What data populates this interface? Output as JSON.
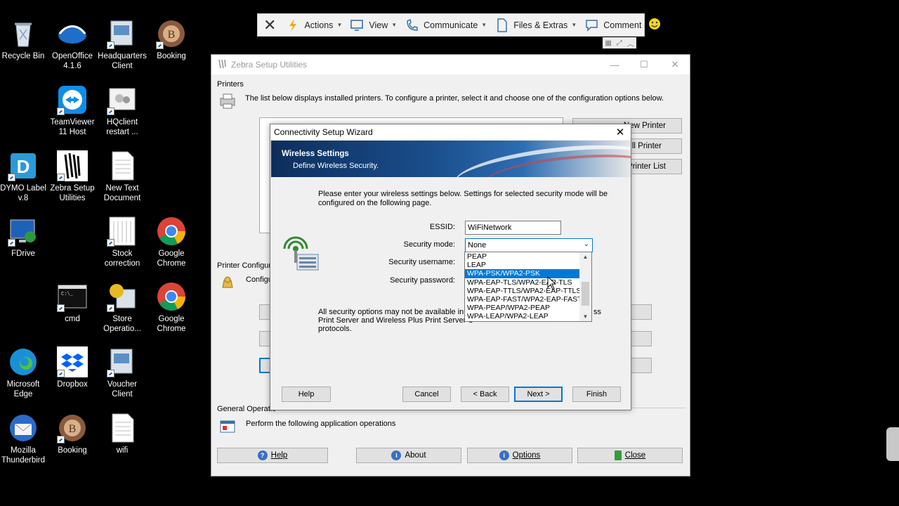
{
  "desktop": {
    "icons": [
      {
        "label": "Recycle Bin",
        "icon": "recycle-bin-icon"
      },
      {
        "label": "OpenOffice 4.1.6",
        "icon": "openoffice-icon"
      },
      {
        "label": "Headquarters Client",
        "icon": "app-icon"
      },
      {
        "label": "Booking",
        "icon": "booking-icon"
      },
      {
        "label": "TeamViewer 11 Host",
        "icon": "teamviewer-icon"
      },
      {
        "label": "HQclient restart ...",
        "icon": "app-icon"
      },
      {
        "label": "DYMO Label v.8",
        "icon": "dymo-icon"
      },
      {
        "label": "Zebra Setup Utilities",
        "icon": "zebra-icon"
      },
      {
        "label": "New Text Document",
        "icon": "text-document-icon"
      },
      {
        "label": "FDrive",
        "icon": "network-drive-icon"
      },
      {
        "label": "Stock correction",
        "icon": "document-icon"
      },
      {
        "label": "Google Chrome",
        "icon": "chrome-icon"
      },
      {
        "label": "cmd",
        "icon": "cmd-icon"
      },
      {
        "label": "Store Operatio...",
        "icon": "app-icon"
      },
      {
        "label": "Google Chrome",
        "icon": "chrome-icon"
      },
      {
        "label": "Microsoft Edge",
        "icon": "edge-icon"
      },
      {
        "label": "Dropbox",
        "icon": "dropbox-icon"
      },
      {
        "label": "Voucher Client",
        "icon": "app-icon"
      },
      {
        "label": "Mozilla Thunderbird",
        "icon": "thunderbird-icon"
      },
      {
        "label": "Booking",
        "icon": "booking-icon"
      },
      {
        "label": "wifi",
        "icon": "text-document-icon"
      }
    ]
  },
  "remote_toolbar": {
    "close": "close-icon",
    "actions": "Actions",
    "view": "View",
    "communicate": "Communicate",
    "files": "Files & Extras",
    "comment": "Comment"
  },
  "zebra": {
    "title": "Zebra Setup Utilities",
    "printers_label": "Printers",
    "printers_desc": "The list below displays installed printers. To configure a printer, select it and choose one of the configuration options below.",
    "new_printer": "New Printer",
    "install_printer": "ll Printer",
    "printer_list": "Printer List",
    "printer_config_label": "Printer Configur",
    "config_text": "Configu",
    "general_ops_label": "General Operatio",
    "general_ops_desc": "Perform the following application operations",
    "help": "Help",
    "about": "About",
    "options": "Options",
    "close": "Close"
  },
  "wizard": {
    "title": "Connectivity Setup Wizard",
    "banner_title": "Wireless Settings",
    "banner_subtitle": "Define Wireless Security.",
    "intro": "Please enter your wireless settings below. Settings for selected security mode will be configured on the following page.",
    "essid_label": "ESSID:",
    "essid_value": "WiFiNetwork",
    "security_mode_label": "Security mode:",
    "security_mode_value": "None",
    "security_username_label": "Security username:",
    "security_password_label": "Security password:",
    "note_line1": "All security options may not be available in",
    "note_tail": "ss",
    "note_line2a": "Print Server and Wireless Plus Print Server U",
    "note_line2b": "protocols.",
    "buttons": {
      "help": "Help",
      "cancel": "Cancel",
      "back": "< Back",
      "next": "Next >",
      "finish": "Finish"
    },
    "security_options": [
      "PEAP",
      "LEAP",
      "WPA-PSK/WPA2-PSK",
      "WPA-EAP-TLS/WPA2-EAP-TLS",
      "WPA-EAP-TTLS/WPA2-EAP-TTLS",
      "WPA-EAP-FAST/WPA2-EAP-FAST",
      "WPA-PEAP/WPA2-PEAP",
      "WPA-LEAP/WPA2-LEAP"
    ],
    "selected_option": "WPA-PSK/WPA2-PSK"
  }
}
